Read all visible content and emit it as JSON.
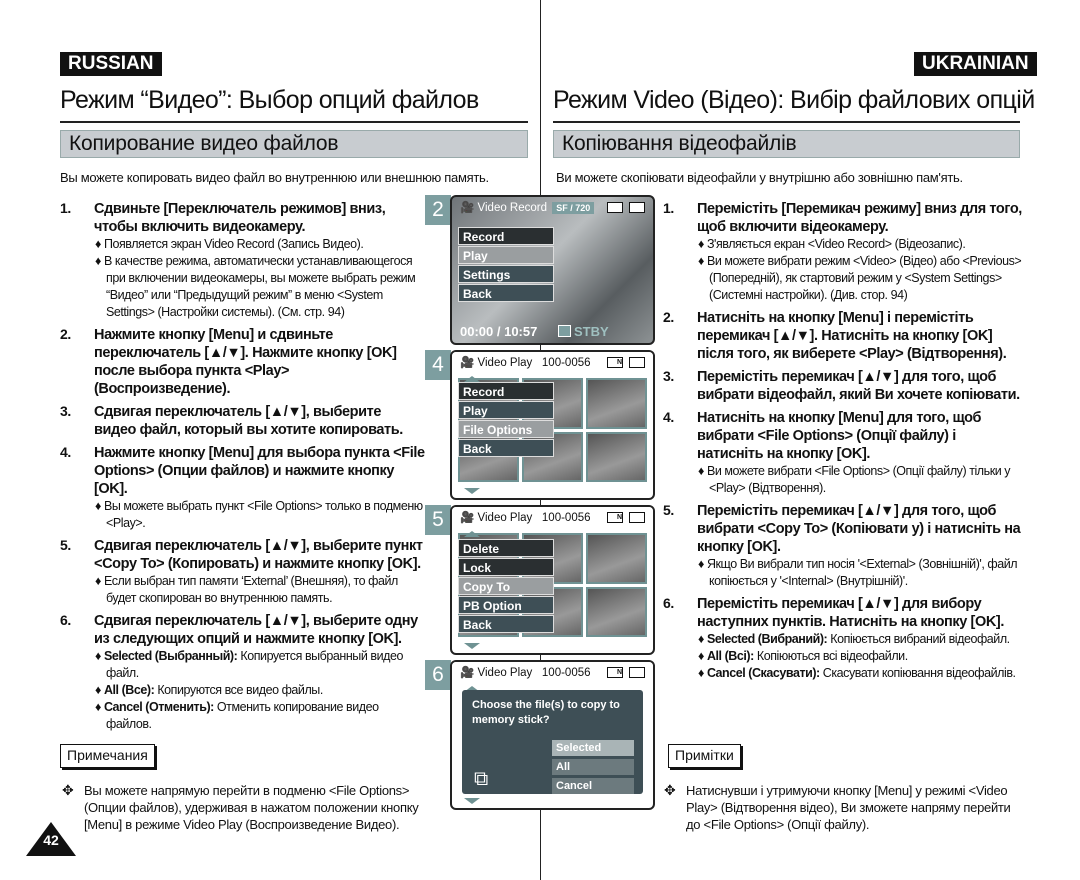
{
  "left": {
    "lang": "RUSSIAN",
    "title": "Режим “Видео”: Выбор опций файлов",
    "section": "Копирование видео файлов",
    "intro": "Вы можете копировать видео файл во внутреннюю или внешнюю память.",
    "steps": [
      {
        "n": "1.",
        "text": "Сдвиньте [Переключатель режимов] вниз, чтобы включить видеокамеру.",
        "bullets": [
          "Появляется экран Video Record (Запись Видео).",
          "В качестве режима, автоматически устанавливающегося при включении видеокамеры, вы можете выбрать режим “Видео” или “Предыдущий режим” в меню <System Settings> (Настройки системы). (См. стр. 94)"
        ]
      },
      {
        "n": "2.",
        "text": "Нажмите кнопку [Menu] и сдвиньте переключатель [▲/▼]. Нажмите кнопку [OK] после выбора пункта <Play> (Воспроизведение).",
        "bullets": []
      },
      {
        "n": "3.",
        "text": "Сдвигая переключатель [▲/▼], выберите видео файл, который вы хотите копировать.",
        "bullets": []
      },
      {
        "n": "4.",
        "text": "Нажмите кнопку [Menu] для выбора пункта <File Options> (Опции файлов) и нажмите кнопку [OK].",
        "bullets": [
          "Вы можете выбрать пункт <File Options> только в подменю <Play>."
        ]
      },
      {
        "n": "5.",
        "text": "Сдвигая переключатель [▲/▼], выберите пункт <Copy To> (Копировать) и нажмите кнопку [OK].",
        "bullets": [
          "Если выбран тип памяти ‘External’ (Внешняя), то файл будет скопирован во внутреннюю память."
        ]
      },
      {
        "n": "6.",
        "text": "Сдвигая переключатель [▲/▼], выберите одну из следующих опций и нажмите кнопку [OK].",
        "bullets": []
      }
    ],
    "options": [
      {
        "term": "Selected (Выбранный):",
        "desc": " Копируется выбранный видео файл."
      },
      {
        "term": "All (Все):",
        "desc": " Копируются все видео файлы."
      },
      {
        "term": "Cancel (Отменить):",
        "desc": " Отменить копирование видео файлов."
      }
    ],
    "notes_label": "Примечания",
    "note": "Вы можете напрямую перейти в подменю <File Options> (Опции файлов), удерживая в нажатом положении кнопку [Menu] в режиме Video Play (Воспроизведение Видео).",
    "page_number": "42"
  },
  "right": {
    "lang": "UKRAINIAN",
    "title": "Режим Video (Відео): Вибір файлових опцій",
    "section": "Копіювання відеофайлів",
    "intro": "Ви можете скопіювати відеофайли у внутрішню або зовнішню пам'ять.",
    "steps": [
      {
        "n": "1.",
        "text": "Перемістіть [Перемикач режиму] вниз для того, щоб включити відеокамеру.",
        "bullets": [
          "З'являється екран <Video Record> (Відеозапис).",
          "Ви можете вибрати режим <Video> (Відео) або <Previous> (Попередній), як стартовий режим у <System Settings> (Системні настройки). (Див. стор. 94)"
        ]
      },
      {
        "n": "2.",
        "text": "Натисніть на кнопку [Menu] і перемістіть перемикач [▲/▼]. Натисніть на кнопку [OK] після того, як виберете <Play> (Відтворення).",
        "bullets": []
      },
      {
        "n": "3.",
        "text": "Перемістіть перемикач [▲/▼] для того, щоб вибрати відеофайл, який Ви хочете копіювати.",
        "bullets": []
      },
      {
        "n": "4.",
        "text": "Натисніть на кнопку [Menu] для того, щоб вибрати <File Options> (Опції файлу) і натисніть на кнопку [OK].",
        "bullets": [
          "Ви можете вибрати <File Options> (Опції файлу) тільки у <Play> (Відтворення)."
        ]
      },
      {
        "n": "5.",
        "text": "Перемістіть перемикач [▲/▼] для того, щоб вибрати <Copy To> (Копіювати у) і натисніть на кнопку [OK].",
        "bullets": [
          "Якщо Ви вибрали тип носія '<External> (Зовнішній)', файл копіюється у '<Internal> (Внутрішній)'."
        ]
      },
      {
        "n": "6.",
        "text": "Перемістіть перемикач [▲/▼] для вибору наступних пунктів. Натисніть на кнопку [OK].",
        "bullets": []
      }
    ],
    "options": [
      {
        "term": "Selected (Вибраний):",
        "desc": " Копіюється вибраний відеофайл."
      },
      {
        "term": "All (Всі):",
        "desc": " Копіюються всі відеофайли."
      },
      {
        "term": "Cancel (Скасувати):",
        "desc": " Скасувати копіювання відеофайлів."
      }
    ],
    "notes_label": "Примітки",
    "note": "Натиснувши і утримуючи кнопку [Menu] у режимі <Video Play> (Відтворення відео), Ви зможете напряму перейти до <File Options> (Опції файлу)."
  },
  "screens": [
    {
      "num": "2",
      "header": "Video Record",
      "badge": "SF / 720",
      "menu": [
        "Record",
        "Play",
        "Settings",
        "Back"
      ],
      "selected": 1,
      "timecode": "00:00 / 10:57",
      "status": "STBY"
    },
    {
      "num": "4",
      "header": "Video Play",
      "file": "100-0056",
      "menu": [
        "Record",
        "Play",
        "File Options",
        "Back"
      ],
      "selected": 2
    },
    {
      "num": "5",
      "header": "Video Play",
      "file": "100-0056",
      "menu": [
        "Delete",
        "Lock",
        "Copy To",
        "PB Option",
        "Back"
      ],
      "selected": 2
    },
    {
      "num": "6",
      "header": "Video Play",
      "file": "100-0056",
      "question": "Choose the file(s) to copy to memory stick?",
      "options": [
        "Selected",
        "All",
        "Cancel"
      ],
      "selected": 0
    }
  ],
  "colors": {
    "accent": "#7d9ea0",
    "menu": "#3e4f56",
    "section_bg": "#c8ccd0"
  }
}
